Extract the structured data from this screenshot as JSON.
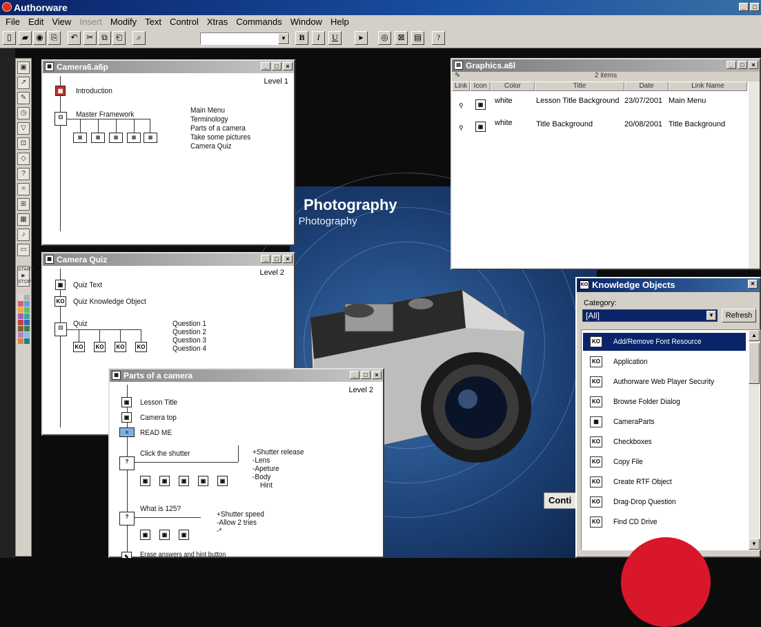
{
  "app": {
    "title": "Authorware"
  },
  "menu": [
    {
      "label": "File",
      "disabled": false
    },
    {
      "label": "Edit",
      "disabled": false
    },
    {
      "label": "View",
      "disabled": false
    },
    {
      "label": "Insert",
      "disabled": true
    },
    {
      "label": "Modify",
      "disabled": false
    },
    {
      "label": "Text",
      "disabled": false
    },
    {
      "label": "Control",
      "disabled": false
    },
    {
      "label": "Xtras",
      "disabled": false
    },
    {
      "label": "Commands",
      "disabled": false
    },
    {
      "label": "Window",
      "disabled": false
    },
    {
      "label": "Help",
      "disabled": false
    }
  ],
  "toolbar": {
    "bold": "B",
    "italic": "I",
    "underline": "U",
    "help": "?",
    "style_value": ""
  },
  "stage": {
    "heading": "Photography",
    "subheading": "n Photography",
    "continue_label": "Conti"
  },
  "camera6": {
    "title": "Camera6.a6p",
    "level": "Level 1",
    "icon1": "Introduction",
    "framework": "Master Framework",
    "pages": [
      "Main Menu",
      "Terminology",
      "Parts of a camera",
      "Take some pictures",
      "Camera Quiz"
    ]
  },
  "quiz": {
    "title": "Camera Quiz",
    "level": "Level 2",
    "icon1": "Quiz Text",
    "icon2": "Quiz Knowledge Object",
    "framework": "Quiz",
    "questions": [
      "Question 1",
      "Question 2",
      "Question 3",
      "Question 4"
    ]
  },
  "parts": {
    "title": "Parts of a camera",
    "level": "Level 2",
    "icon1": "Lesson Title",
    "icon2": "Camera top",
    "icon3": "READ ME",
    "interaction1": "Click the shutter",
    "responses1": [
      "+Shutter release",
      "-Lens",
      "-Apeture",
      "-Body",
      "Hint"
    ],
    "interaction2": "What is 125?",
    "responses2": [
      "+Shutter speed",
      "-Allow 2 tries",
      "-*"
    ],
    "footer": "Erase answers and hint button"
  },
  "graphics": {
    "title": "Graphics.a6l",
    "items_count": "2 items",
    "columns": [
      "Link",
      "Icon",
      "Color",
      "Title",
      "Date",
      "Link Name"
    ],
    "rows": [
      {
        "color": "white",
        "title": "Lesson Title Background",
        "date": "23/07/2001",
        "link_name": "Main Menu"
      },
      {
        "color": "white",
        "title": "Title Background",
        "date": "20/08/2001",
        "link_name": "Title Background"
      }
    ]
  },
  "knowledge": {
    "title": "Knowledge Objects",
    "category_label": "Category:",
    "category_value": "[All]",
    "refresh": "Refresh",
    "items": [
      "Add/Remove Font Resource",
      "Application",
      "Authorware Web Player Security",
      "Browse Folder Dialog",
      "CameraParts",
      "Checkboxes",
      "Copy File",
      "Create RTF Object",
      "Drag-Drop Question",
      "Find CD Drive"
    ],
    "selected_index": 0
  },
  "colors": {
    "titlebar": "#0a246a",
    "stage": "#1b3f73",
    "inactive_title": "#8a8a8a",
    "logo": "#d8182a"
  }
}
